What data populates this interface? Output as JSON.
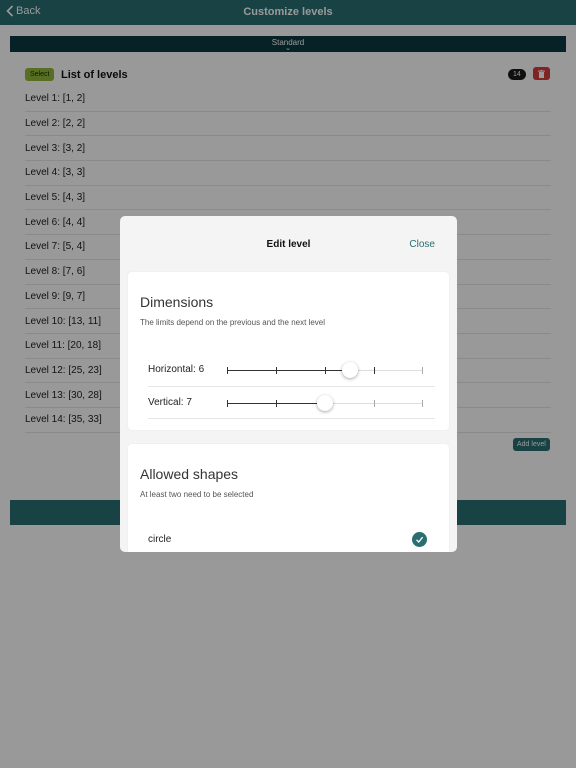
{
  "navbar": {
    "back_label": "Back",
    "title": "Customize levels"
  },
  "segment": {
    "label": "Standard"
  },
  "list": {
    "select_label": "Select",
    "title": "List of levels",
    "count": "14",
    "levels": [
      "Level 1: [1, 2]",
      "Level 2: [2, 2]",
      "Level 3: [3, 2]",
      "Level 4: [3, 3]",
      "Level 5: [4, 3]",
      "Level 6: [4, 4]",
      "Level 7: [5, 4]",
      "Level 8: [7, 6]",
      "Level 9: [9, 7]",
      "Level 10: [13, 11]",
      "Level 11: [20, 18]",
      "Level 12: [25, 23]",
      "Level 13: [30, 28]",
      "Level 14: [35, 33]"
    ],
    "add_label": "Add level"
  },
  "modal": {
    "title": "Edit level",
    "close_label": "Close",
    "dimensions": {
      "heading": "Dimensions",
      "subtitle": "The limits depend on the previous and the next level",
      "horizontal": {
        "label": "Horizontal: 6",
        "value": 6,
        "min": 1,
        "max": 9,
        "allowed_max": 8
      },
      "vertical": {
        "label": "Vertical: 7",
        "value": 7,
        "min": 5,
        "max": 9,
        "allowed_max": 7
      }
    },
    "shapes": {
      "heading": "Allowed shapes",
      "subtitle": "At least two need to be selected",
      "items": [
        {
          "label": "circle",
          "checked": true
        }
      ]
    }
  },
  "colors": {
    "primary": "#2a6e72",
    "dark": "#0d3a40",
    "accent_green": "#8fb93b",
    "danger": "#d43b3b"
  }
}
